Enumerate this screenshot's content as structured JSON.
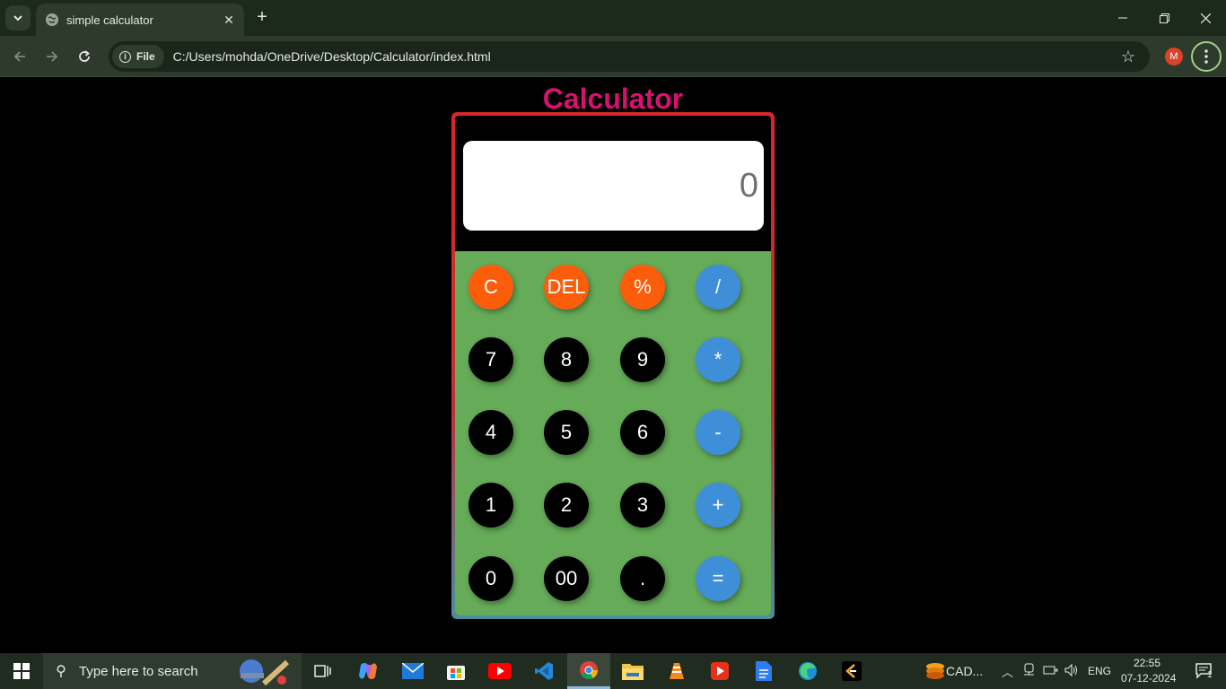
{
  "browser": {
    "tab_title": "simple calculator",
    "new_tab_label": "+",
    "chip_label": "File",
    "url": "C:/Users/mohda/OneDrive/Desktop/Calculator/index.html",
    "profile_initial": "M"
  },
  "app": {
    "title": "Calculator",
    "display_value": "0",
    "keys": {
      "clear": "C",
      "delete": "DEL",
      "percent": "%",
      "divide": "/",
      "seven": "7",
      "eight": "8",
      "nine": "9",
      "multiply": "*",
      "four": "4",
      "five": "5",
      "six": "6",
      "subtract": "-",
      "one": "1",
      "two": "2",
      "three": "3",
      "add": "+",
      "zero": "0",
      "double_zero": "00",
      "decimal": ".",
      "equals": "="
    }
  },
  "taskbar": {
    "search_placeholder": "Type here to search",
    "app_label": "CAD...",
    "language": "ENG",
    "time": "22:55",
    "date": "07-12-2024",
    "notification_count": "1"
  }
}
